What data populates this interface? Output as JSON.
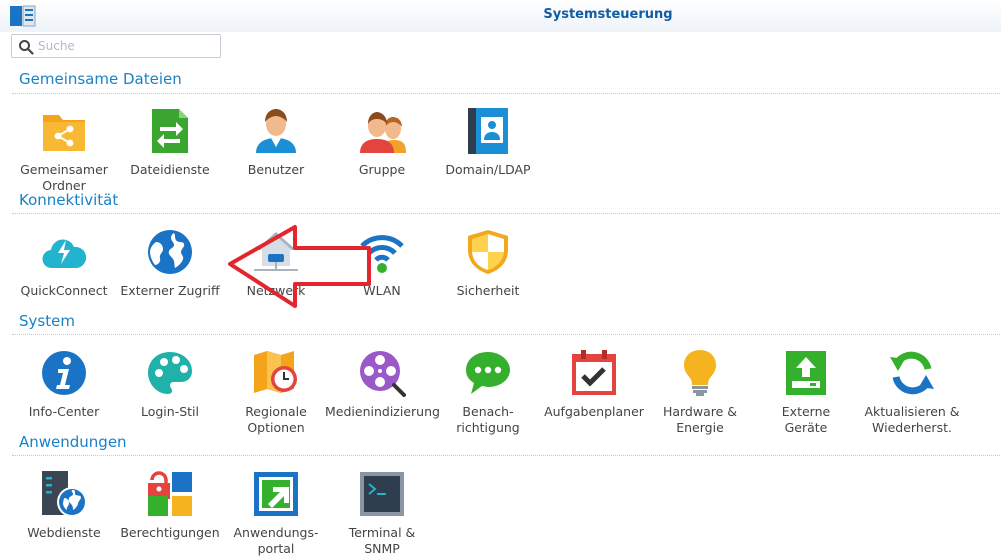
{
  "window": {
    "title": "Systemsteuerung"
  },
  "search": {
    "placeholder": "Suche",
    "value": ""
  },
  "sections": [
    {
      "title": "Gemeinsame Dateien",
      "items": [
        {
          "label": "Gemeinsamer\nOrdner",
          "icon": "shared-folder-icon"
        },
        {
          "label": "Dateidienste",
          "icon": "file-services-icon"
        },
        {
          "label": "Benutzer",
          "icon": "user-icon"
        },
        {
          "label": "Gruppe",
          "icon": "group-icon"
        },
        {
          "label": "Domain/LDAP",
          "icon": "domain-ldap-icon"
        }
      ]
    },
    {
      "title": "Konnektivität",
      "items": [
        {
          "label": "QuickConnect",
          "icon": "quickconnect-icon"
        },
        {
          "label": "Externer Zugriff",
          "icon": "globe-icon"
        },
        {
          "label": "Netzwerk",
          "icon": "network-house-icon"
        },
        {
          "label": "WLAN",
          "icon": "wifi-icon"
        },
        {
          "label": "Sicherheit",
          "icon": "shield-icon"
        }
      ]
    },
    {
      "title": "System",
      "items": [
        {
          "label": "Info-Center",
          "icon": "info-icon"
        },
        {
          "label": "Login-Stil",
          "icon": "palette-icon"
        },
        {
          "label": "Regionale\nOptionen",
          "icon": "map-clock-icon"
        },
        {
          "label": "Medienindizierung",
          "icon": "film-reel-icon"
        },
        {
          "label": "Benach-\nrichtigung",
          "icon": "chat-bubble-icon"
        },
        {
          "label": "Aufgabenplaner",
          "icon": "calendar-check-icon"
        },
        {
          "label": "Hardware &\nEnergie",
          "icon": "lightbulb-icon"
        },
        {
          "label": "Externe\nGeräte",
          "icon": "external-device-icon"
        },
        {
          "label": "Aktualisieren &\nWiederherst.",
          "icon": "refresh-icon"
        }
      ]
    },
    {
      "title": "Anwendungen",
      "items": [
        {
          "label": "Webdienste",
          "icon": "web-services-icon"
        },
        {
          "label": "Berechtigungen",
          "icon": "lock-permissions-icon"
        },
        {
          "label": "Anwendungs-\nportal",
          "icon": "app-portal-icon"
        },
        {
          "label": "Terminal &\nSNMP",
          "icon": "terminal-icon"
        }
      ]
    }
  ],
  "colors": {
    "accent": "#1a82c7",
    "title": "#0f5da6",
    "arrow": "#e3262d"
  }
}
